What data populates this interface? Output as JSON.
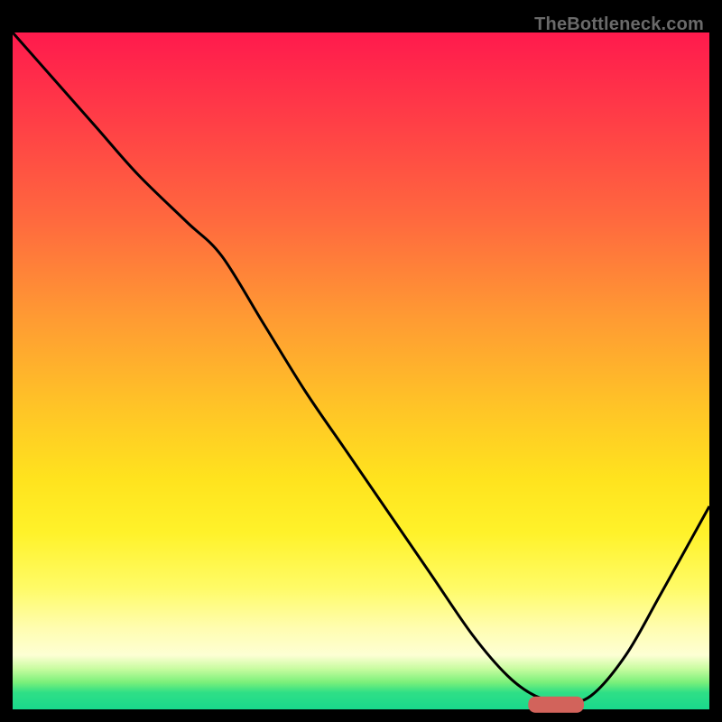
{
  "watermark": "TheBottleneck.com",
  "gradient_colors": {
    "top": "#ff1a4d",
    "mid_upper": "#ff9a33",
    "mid": "#ffe31e",
    "pale": "#fffdb0",
    "green": "#19d98c"
  },
  "curve": {
    "stroke": "#000000",
    "stroke_width": 3
  },
  "marker": {
    "fill": "#d2635b",
    "rx": 8
  },
  "chart_data": {
    "type": "line",
    "title": "",
    "xlabel": "",
    "ylabel": "",
    "xlim": [
      0,
      100
    ],
    "ylim": [
      0,
      100
    ],
    "x": [
      0,
      6,
      12,
      18,
      25,
      30,
      36,
      42,
      48,
      54,
      60,
      66,
      71,
      75,
      79,
      83,
      88,
      93,
      100
    ],
    "values": [
      100,
      93,
      86,
      79,
      72,
      67,
      57,
      47,
      38,
      29,
      20,
      11,
      5,
      2,
      1,
      2,
      8,
      17,
      30
    ],
    "annotations": [
      {
        "kind": "marker",
        "shape": "rounded-rect",
        "x_start": 74,
        "x_end": 82,
        "y": 0.7
      }
    ],
    "notes": "Background is a bottleneck heat gradient (red high → green low). Curve is the bottleneck % vs. some swept parameter; minimum ≈ x 75–80."
  }
}
